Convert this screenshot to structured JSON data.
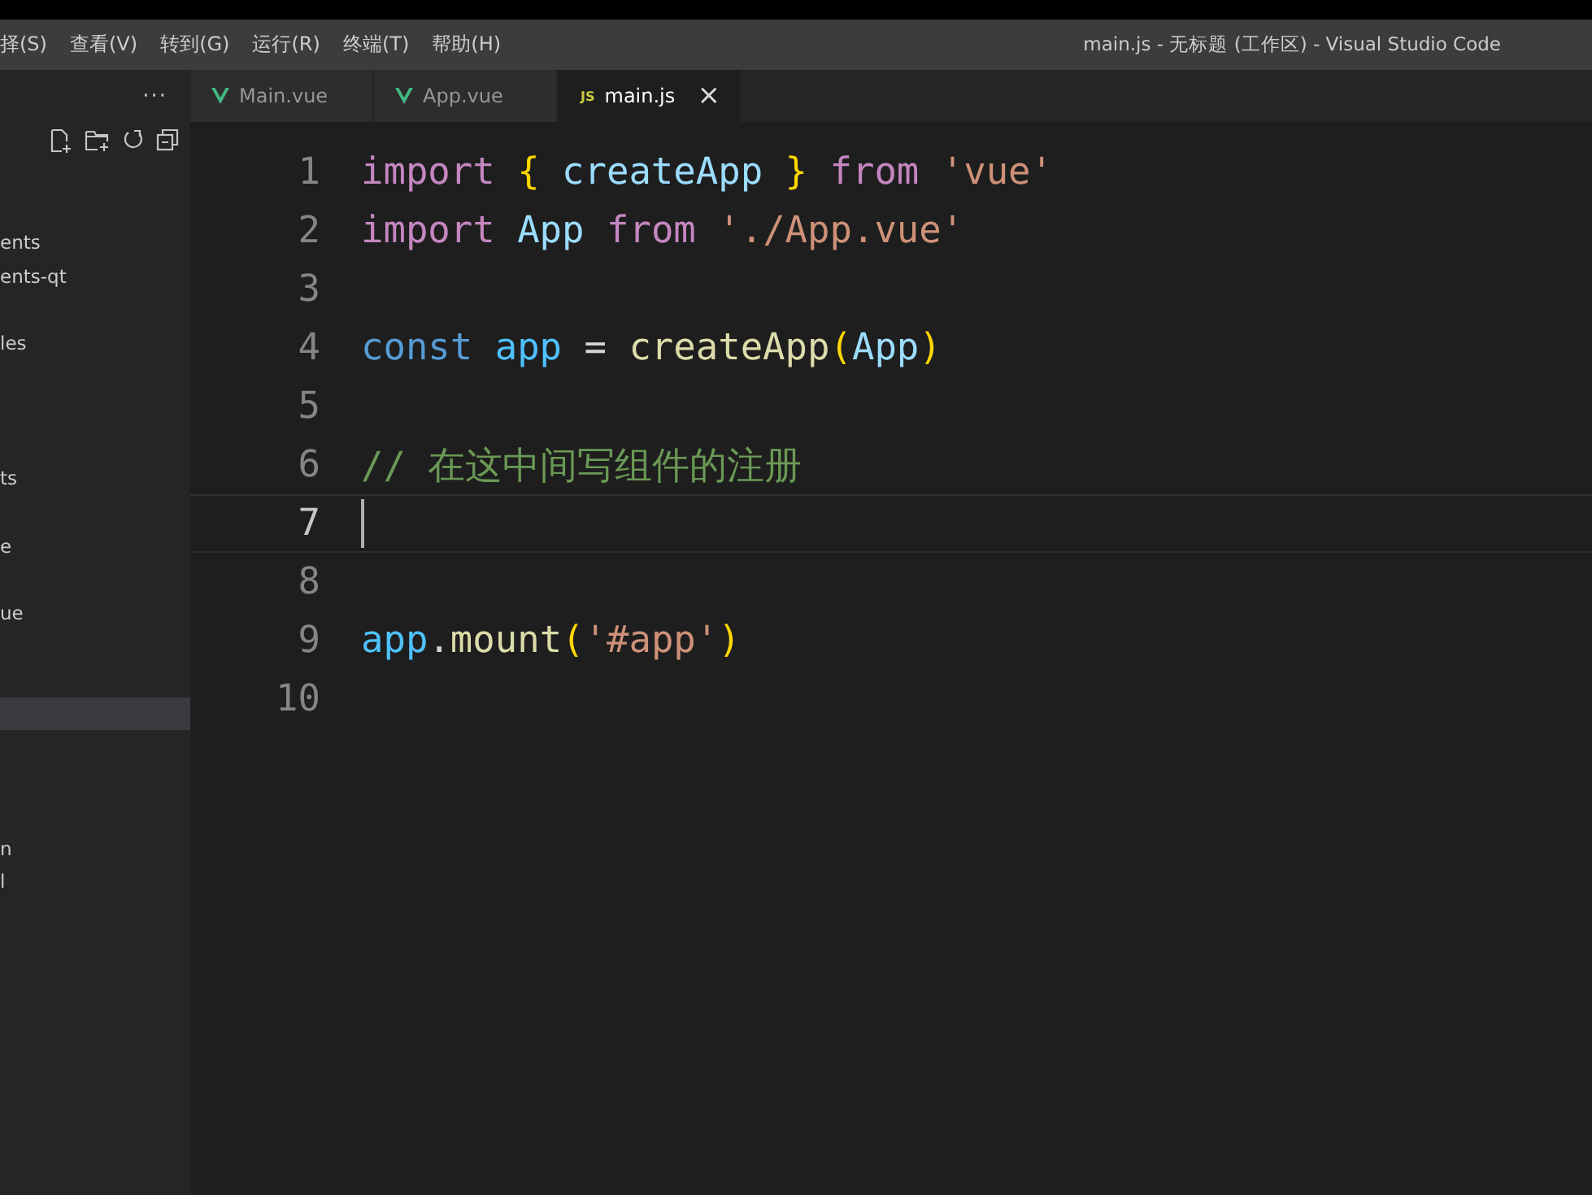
{
  "menu": [
    "择(S)",
    "查看(V)",
    "转到(G)",
    "运行(R)",
    "终端(T)",
    "帮助(H)"
  ],
  "window": {
    "title": "main.js - 无标题 (工作区) - Visual Studio Code"
  },
  "sidebar": {
    "more": "···",
    "items": [
      {
        "label": "ents",
        "selected": false
      },
      {
        "label": "ents-qt",
        "selected": false
      },
      {
        "selected": false
      },
      {
        "label": "les",
        "selected": false
      },
      {
        "selected": false
      },
      {
        "selected": false
      },
      {
        "selected": false
      },
      {
        "label": "ts",
        "selected": false
      },
      {
        "selected": false
      },
      {
        "label": "e",
        "selected": false
      },
      {
        "selected": false
      },
      {
        "label": "ue",
        "selected": false
      },
      {
        "selected": false
      },
      {
        "selected": false
      },
      {
        "selected": true
      },
      {
        "selected": false
      },
      {
        "selected": false
      },
      {
        "selected": false
      },
      {
        "label": "n",
        "selected": false
      },
      {
        "label": "l",
        "selected": false
      }
    ]
  },
  "tabs": [
    {
      "kind": "vue",
      "label": "Main.vue",
      "selected": false
    },
    {
      "kind": "vue",
      "label": "App.vue",
      "selected": false
    },
    {
      "kind": "js",
      "badge": "JS",
      "label": "main.js",
      "selected": true,
      "close": "×"
    }
  ],
  "editor": {
    "lines": [
      {
        "number": "1",
        "current": false,
        "tokens": [
          {
            "kind": "keyword",
            "text": "import"
          },
          {
            "kind": "brace",
            "text": " {"
          },
          {
            "kind": "variable",
            "text": " createApp"
          },
          {
            "kind": "brace",
            "text": " }"
          },
          {
            "kind": "keyword",
            "text": " from"
          },
          {
            "kind": "string",
            "text": " 'vue'"
          }
        ]
      },
      {
        "number": "2",
        "current": false,
        "tokens": [
          {
            "kind": "keyword",
            "text": "import"
          },
          {
            "kind": "variable",
            "text": " App"
          },
          {
            "kind": "keyword",
            "text": " from"
          },
          {
            "kind": "string",
            "text": " './App.vue'"
          }
        ]
      },
      {
        "number": "3",
        "current": false
      },
      {
        "number": "4",
        "current": false,
        "tokens": [
          {
            "kind": "storage",
            "text": "const"
          },
          {
            "kind": "constant",
            "text": " app"
          },
          {
            "kind": "plain",
            "text": " ="
          },
          {
            "kind": "function",
            "text": " createApp"
          },
          {
            "kind": "brace",
            "text": "("
          },
          {
            "kind": "variable",
            "text": "App"
          },
          {
            "kind": "brace",
            "text": ")"
          }
        ]
      },
      {
        "number": "5",
        "current": false
      },
      {
        "number": "6",
        "current": false,
        "tokens": [
          {
            "kind": "comment",
            "text": "// 在这中间写组件的注册"
          }
        ]
      },
      {
        "number": "7",
        "current": true
      },
      {
        "number": "8",
        "current": false
      },
      {
        "number": "9",
        "current": false,
        "tokens": [
          {
            "kind": "constant",
            "text": "app"
          },
          {
            "kind": "plain",
            "text": "."
          },
          {
            "kind": "function",
            "text": "mount"
          },
          {
            "kind": "brace",
            "text": "("
          },
          {
            "kind": "string",
            "text": "'#app'"
          },
          {
            "kind": "brace",
            "text": ")"
          }
        ]
      },
      {
        "number": "10",
        "current": false
      }
    ]
  }
}
